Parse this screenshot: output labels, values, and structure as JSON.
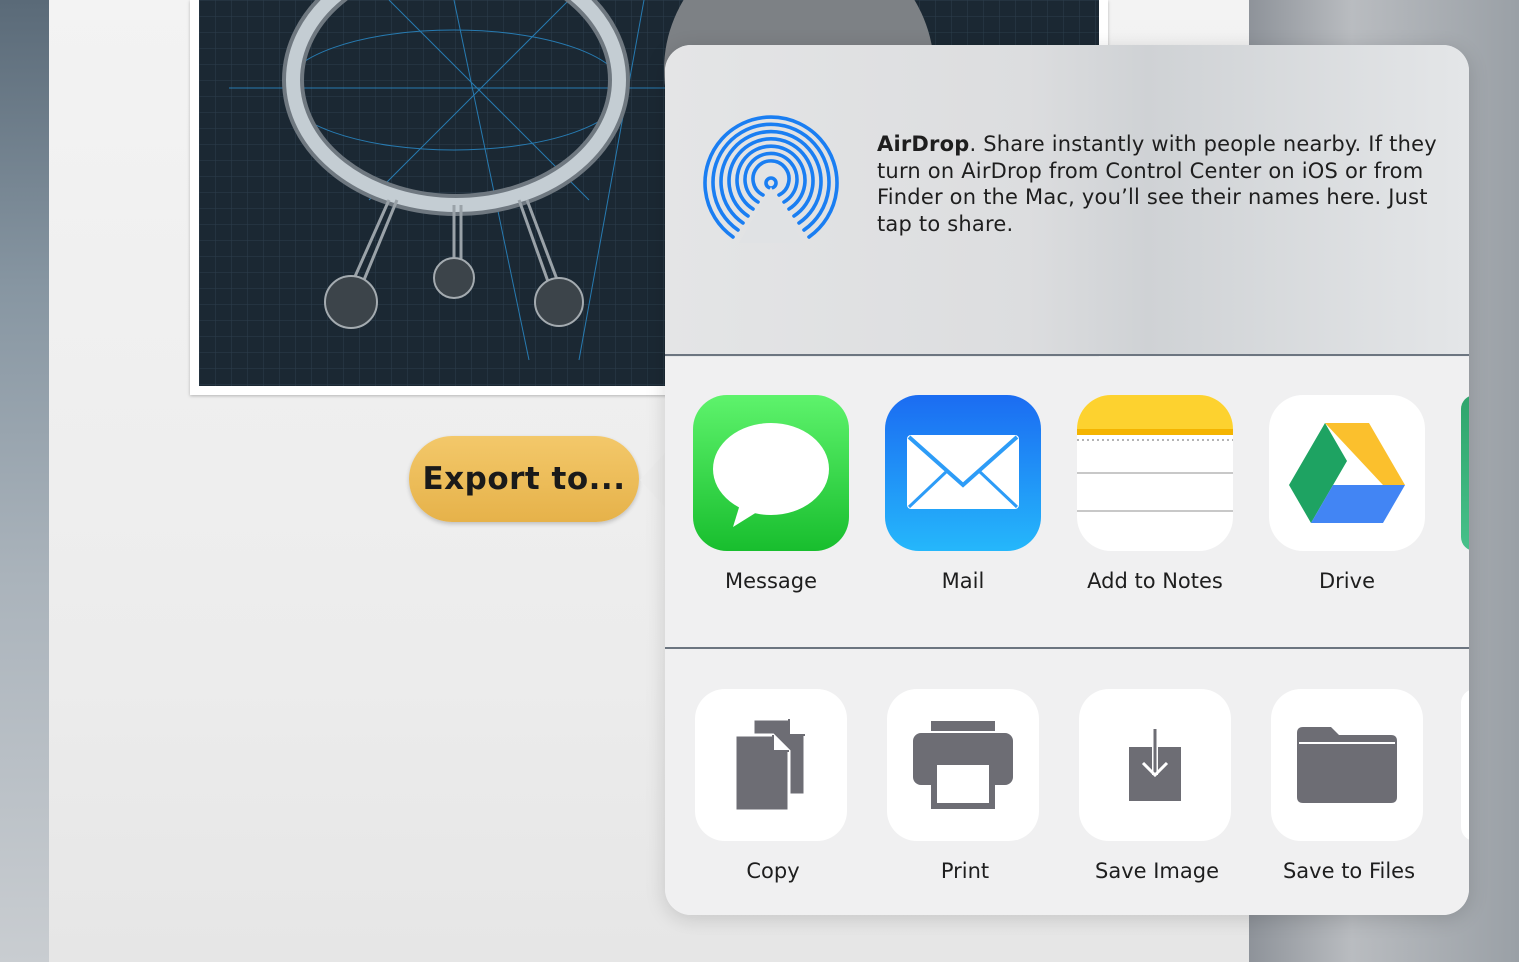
{
  "export_button": {
    "label": "Export to..."
  },
  "share_sheet": {
    "airdrop": {
      "title": "AirDrop",
      "description": ". Share instantly with people nearby. If they turn on AirDrop from Control Center on iOS or from Finder on the Mac, you’ll see their names here. Just tap to share.",
      "icon": "airdrop-icon",
      "color": "#1a7ef2"
    },
    "apps": [
      {
        "label": "Message",
        "icon": "messages-icon"
      },
      {
        "label": "Mail",
        "icon": "mail-icon"
      },
      {
        "label": "Add to Notes",
        "icon": "notes-icon"
      },
      {
        "label": "Drive",
        "icon": "google-drive-icon"
      }
    ],
    "actions": [
      {
        "label": "Copy",
        "icon": "copy-icon"
      },
      {
        "label": "Print",
        "icon": "print-icon"
      },
      {
        "label": "Save Image",
        "icon": "save-image-icon"
      },
      {
        "label": "Save to Files",
        "icon": "folder-icon"
      }
    ]
  },
  "colors": {
    "export_button": "#e9b850",
    "messages_green": "#34c84a",
    "mail_blue": "#1e8ef6",
    "notes_yellow": "#fdd030",
    "action_glyph": "#6d6d74"
  }
}
